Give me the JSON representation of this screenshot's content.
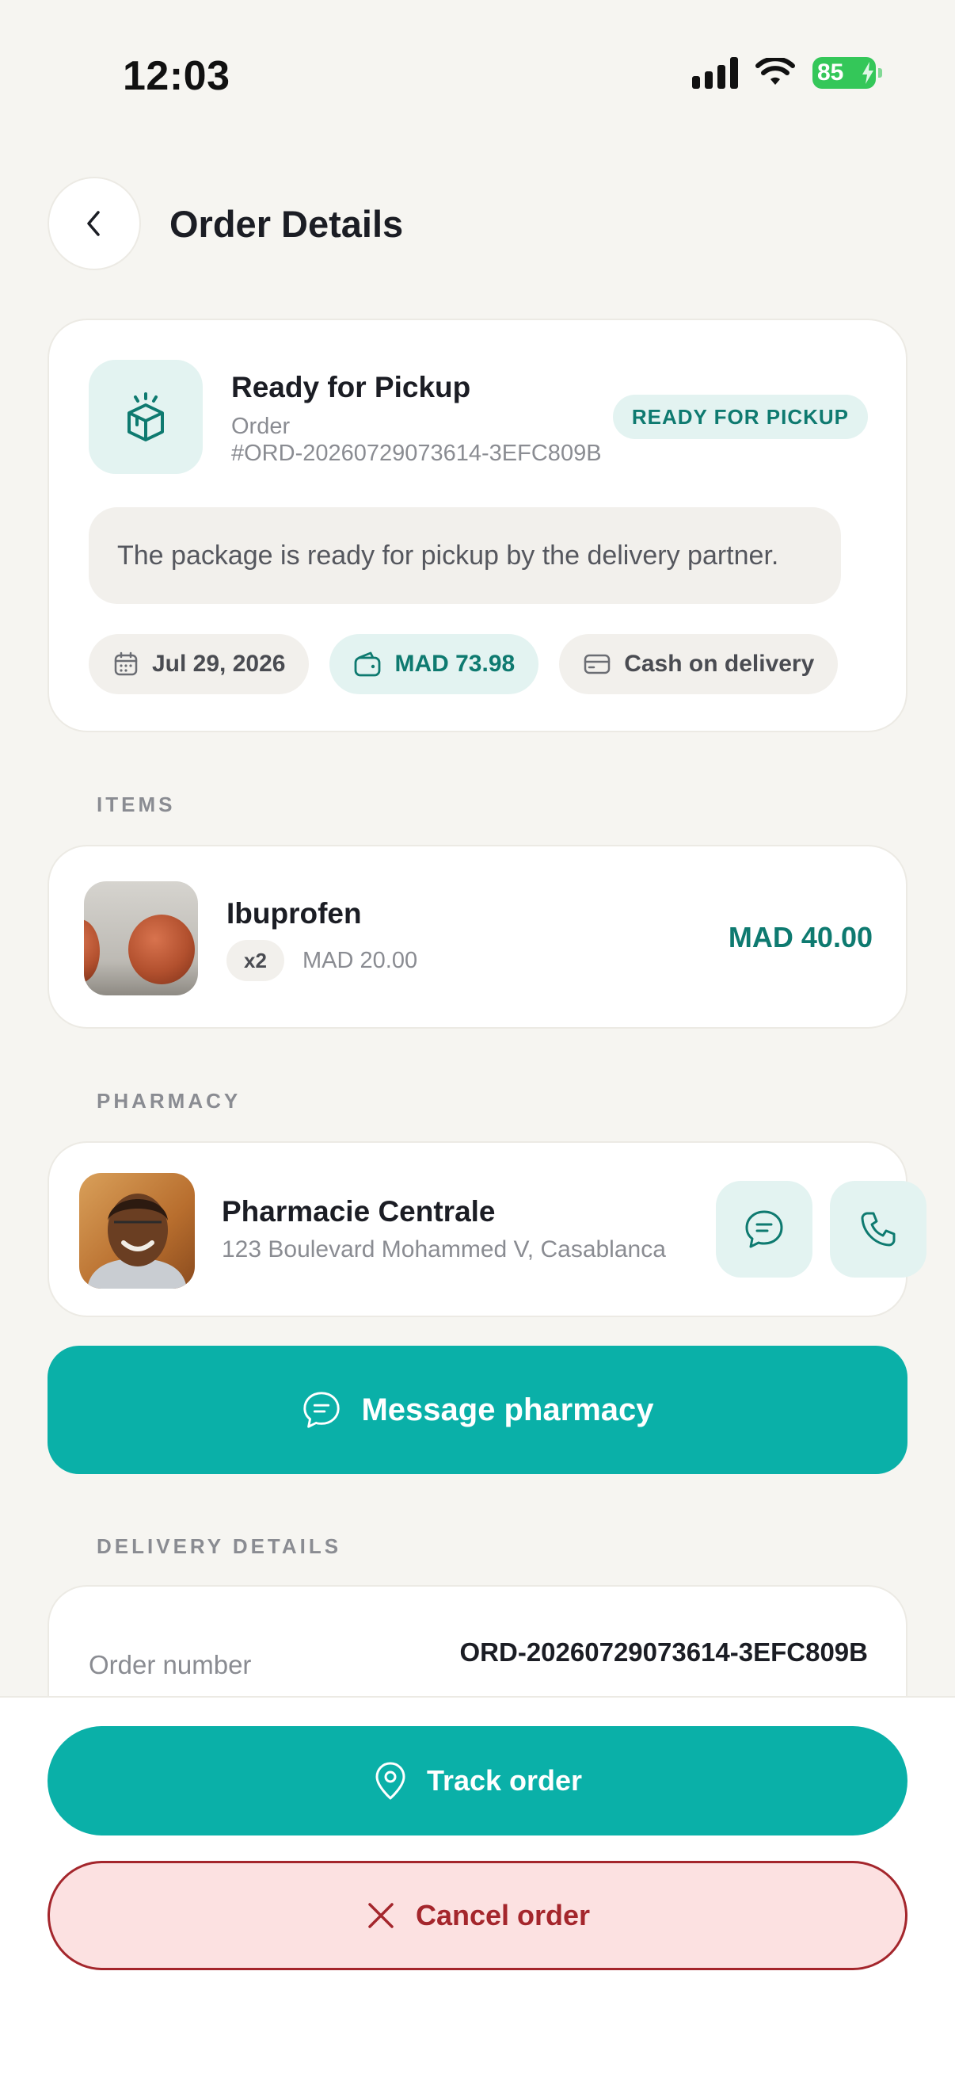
{
  "status_bar": {
    "time": "12:03",
    "battery": "85",
    "icons": [
      "signal-icon",
      "wifi-icon",
      "battery-icon"
    ]
  },
  "header": {
    "title": "Order Details"
  },
  "order": {
    "status_title": "Ready for Pickup",
    "order_label": "Order",
    "order_id": "#ORD-20260729073614-3EFC809B",
    "status_badge": "READY FOR PICKUP",
    "status_message": "The package is ready for pickup by the delivery partner.",
    "date": "Jul 29, 2026",
    "total": "MAD 73.98",
    "payment": "Cash on delivery"
  },
  "sections": {
    "items": "ITEMS",
    "pharmacy": "PHARMACY",
    "delivery": "DELIVERY DETAILS"
  },
  "items": [
    {
      "name": "Ibuprofen",
      "qty": "x2",
      "unit_price": "MAD 20.00",
      "line_total": "MAD 40.00"
    }
  ],
  "pharmacy": {
    "name": "Pharmacie Centrale",
    "address": "123 Boulevard Mohammed V, Casablanca"
  },
  "actions": {
    "message_pharmacy": "Message pharmacy",
    "track_order": "Track order",
    "cancel_order": "Cancel order"
  },
  "delivery_details": {
    "order_number_label": "Order number",
    "order_number_value": "ORD-20260729073614-3EFC809B"
  },
  "colors": {
    "accent": "#0AB0A8",
    "accent_dark": "#0E7A70",
    "accent_light": "#E3F3F1",
    "danger": "#A4262C",
    "danger_bg": "#FCE1E1",
    "background": "#F6F5F1"
  }
}
